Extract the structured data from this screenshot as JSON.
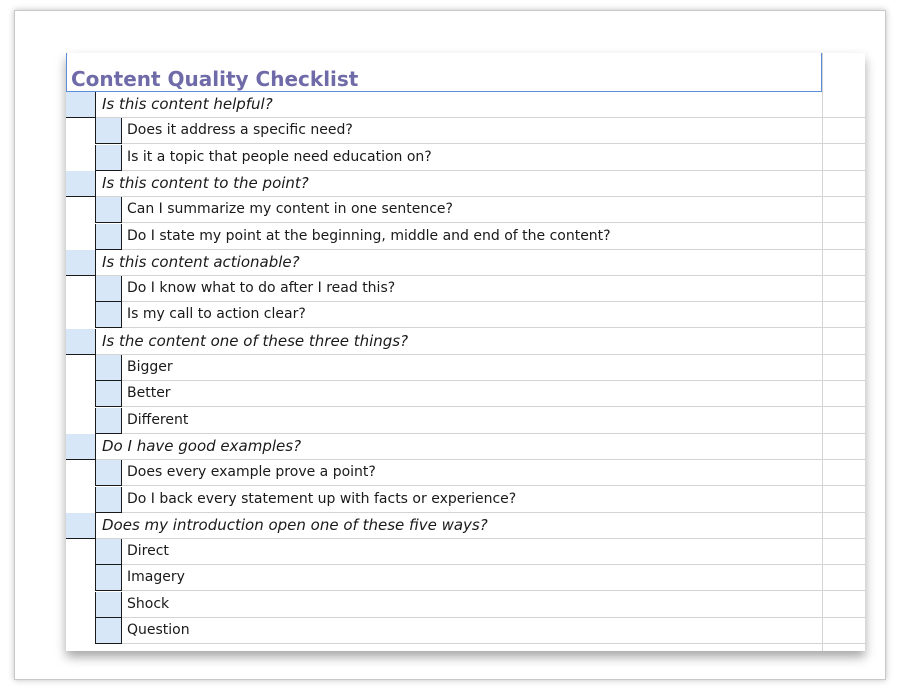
{
  "title": "Content Quality Checklist",
  "sections": [
    {
      "question": "Is this content helpful?",
      "items": [
        "Does it address a specific need?",
        "Is it a topic that people need education on?"
      ]
    },
    {
      "question": "Is this content to the point?",
      "items": [
        "Can I summarize my content in one sentence?",
        "Do I state my point at the beginning, middle and end of the content?"
      ]
    },
    {
      "question": "Is this content actionable?",
      "items": [
        "Do I know what to do after I read this?",
        "Is my call to action clear?"
      ]
    },
    {
      "question": "Is the content one of these three things?",
      "items": [
        "Bigger",
        "Better",
        "Different"
      ]
    },
    {
      "question": "Do I have good examples?",
      "items": [
        "Does every example prove a point?",
        "Do I back every statement up with facts or experience?"
      ]
    },
    {
      "question": "Does my introduction open one of these five ways?",
      "items": [
        "Direct",
        "Imagery",
        "Shock",
        "Question"
      ]
    }
  ]
}
